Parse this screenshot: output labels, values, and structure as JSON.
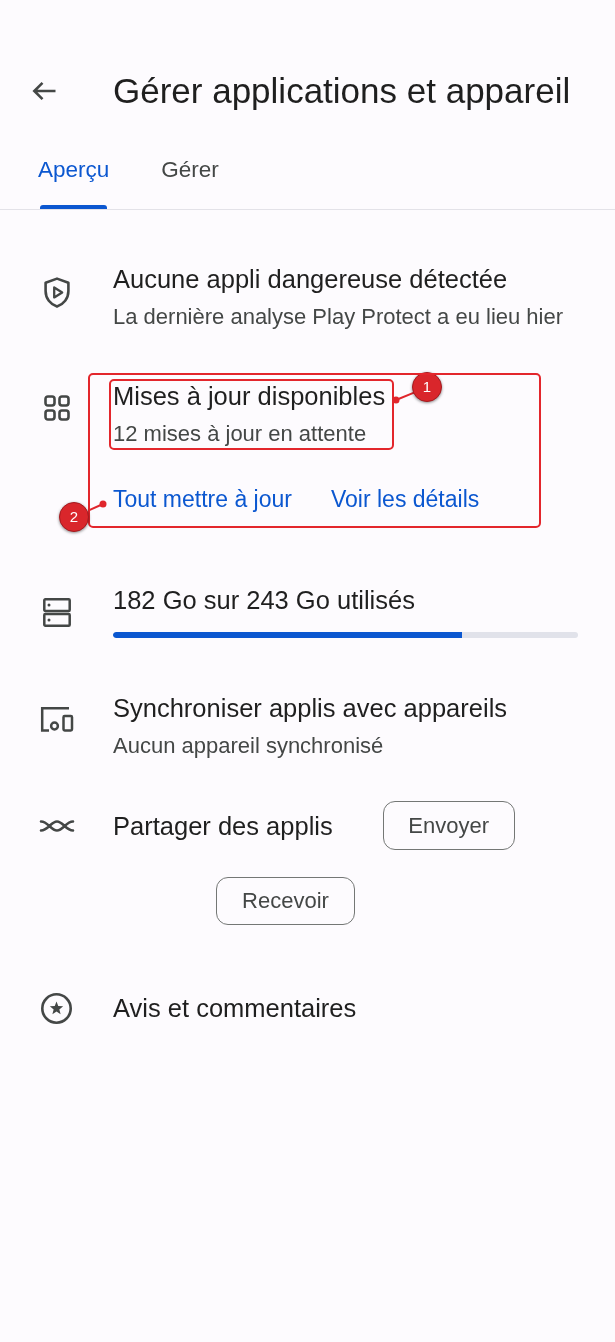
{
  "header": {
    "title": "Gérer applications et appareil"
  },
  "tabs": [
    {
      "label": "Aperçu",
      "selected": true
    },
    {
      "label": "Gérer",
      "selected": false
    }
  ],
  "sections": [
    {
      "kind": "protect",
      "title": "Aucune appli dangereuse détectée",
      "subtitle": "La dernière analyse Play Protect a eu lieu hier"
    },
    {
      "kind": "updates",
      "title": "Mises à jour disponibles",
      "subtitle": "12 mises à jour en attente",
      "actions": [
        "Tout mettre à jour",
        "Voir les détails"
      ]
    },
    {
      "kind": "storage",
      "title": "182 Go sur 243 Go utilisés",
      "level": 0.75
    },
    {
      "kind": "sync",
      "title": "Synchroniser applis avec appareils",
      "subtitle": "Aucun appareil synchronisé"
    },
    {
      "kind": "share",
      "title": "Partager des applis",
      "buttons": [
        "Envoyer",
        "Recevoir"
      ]
    },
    {
      "kind": "ratings",
      "title": "Avis et commentaires"
    }
  ],
  "annotations": [
    {
      "label": "1"
    },
    {
      "label": "2"
    }
  ]
}
